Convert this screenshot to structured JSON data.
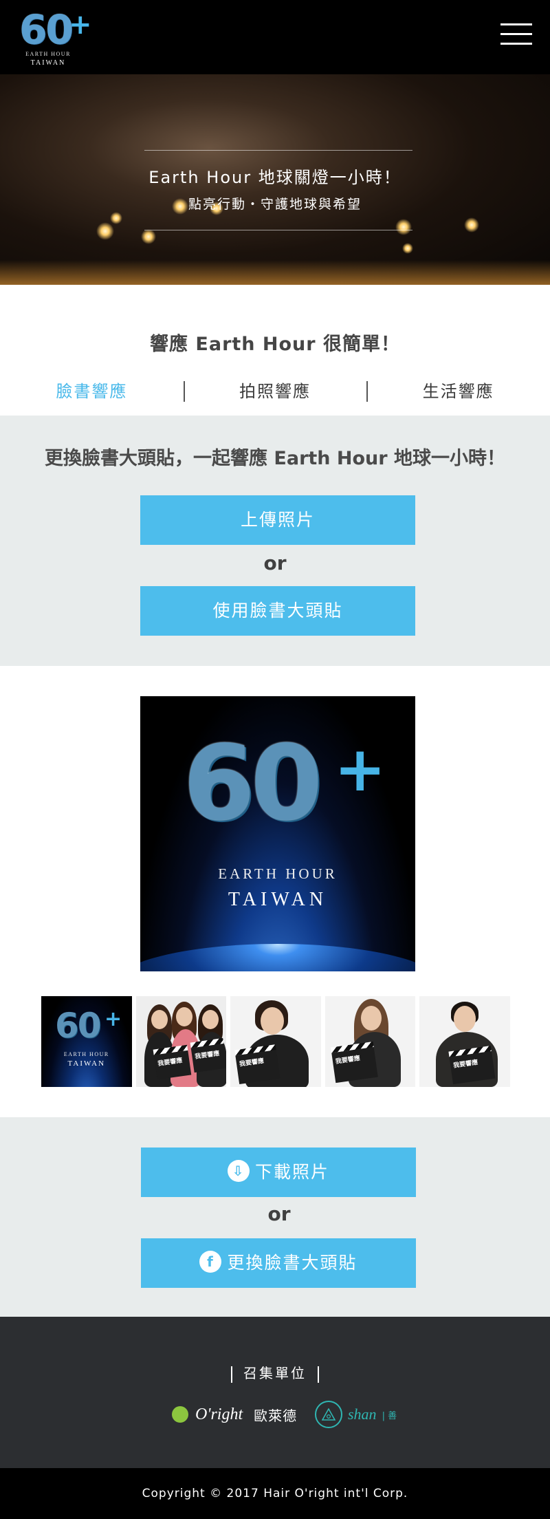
{
  "header": {
    "logo_number": "60",
    "logo_plus": "+",
    "logo_line1": "EARTH HOUR",
    "logo_line2": "TAIWAN",
    "menu_icon": "hamburger-menu-icon"
  },
  "hero": {
    "title": "Earth Hour 地球關燈一小時！",
    "subtitle": "點亮行動・守護地球與希望"
  },
  "intro": {
    "heading": "響應 Earth Hour 很簡單！",
    "tabs": [
      {
        "label": "臉書響應",
        "active": true
      },
      {
        "label": "拍照響應",
        "active": false
      },
      {
        "label": "生活響應",
        "active": false
      }
    ]
  },
  "upload": {
    "heading": "更換臉書大頭貼，一起響應 Earth Hour 地球一小時！",
    "upload_button": "上傳照片",
    "or": "or",
    "use_profile_button": "使用臉書大頭貼"
  },
  "preview": {
    "poster_number": "60",
    "poster_plus": "+",
    "poster_line1": "EARTH HOUR",
    "poster_line2": "TAIWAN",
    "thumbs": [
      {
        "kind": "logo",
        "number": "60",
        "plus": "+",
        "line1": "EARTH HOUR",
        "line2": "TAIWAN"
      },
      {
        "kind": "photo",
        "board_text": "我要響應"
      },
      {
        "kind": "photo",
        "board_text": "我要響應"
      },
      {
        "kind": "photo",
        "board_text": "我要響應"
      },
      {
        "kind": "photo",
        "board_text": "我要響應"
      }
    ]
  },
  "download": {
    "download_button": "下載照片",
    "download_icon": "download-icon",
    "or": "or",
    "facebook_button": "更換臉書大頭貼",
    "facebook_icon": "facebook-icon"
  },
  "footer": {
    "organizer_label": "召集單位",
    "sponsor1_logo": "O'right",
    "sponsor1_name": "歐萊德",
    "sponsor2_logo": "shan",
    "sponsor2_cn": "| 善"
  },
  "copyright": "Copyright © 2017 Hair O'right int'l Corp.",
  "colors": {
    "accent": "#4dbdec",
    "active_tab": "#4ab9ea",
    "section_grey": "#e8ecec",
    "footer_bg": "#2c2e31",
    "brand_green": "#8cc63f",
    "brand_teal": "#2fb6b2"
  }
}
